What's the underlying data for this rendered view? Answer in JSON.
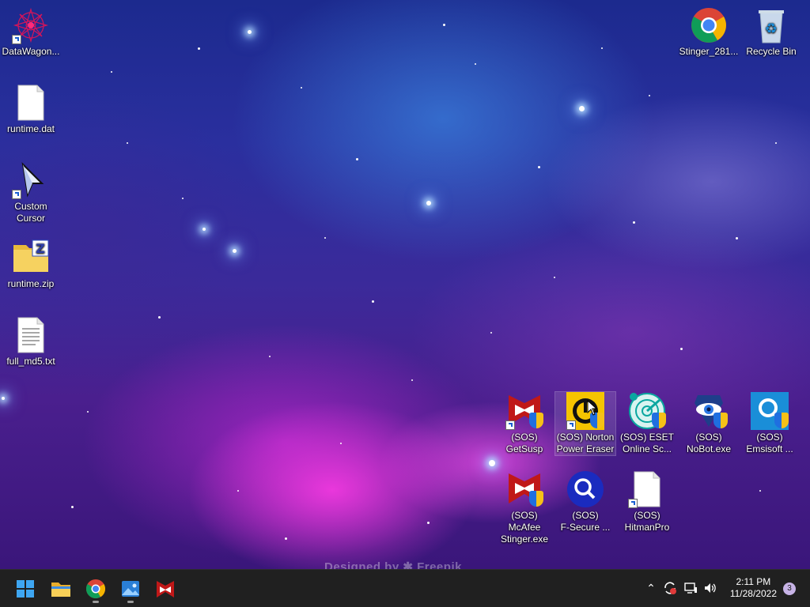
{
  "desktop": {
    "left_icons": [
      {
        "label": "DataWagon..."
      },
      {
        "label": "runtime.dat"
      },
      {
        "label": "Custom\nCursor"
      },
      {
        "label": "runtime.zip"
      },
      {
        "label": "full_md5.txt"
      }
    ],
    "top_right_icons": [
      {
        "label": "Stinger_281..."
      },
      {
        "label": "Recycle Bin"
      }
    ],
    "grid_icons": [
      {
        "label": "(SOS)\nGetSusp"
      },
      {
        "label": "(SOS) Norton\nPower Eraser"
      },
      {
        "label": "(SOS) ESET\nOnline Sc..."
      },
      {
        "label": "(SOS)\nNoBot.exe"
      },
      {
        "label": "(SOS)\nEmsisoft ..."
      },
      {
        "label": "(SOS) McAfee\nStinger.exe"
      },
      {
        "label": "(SOS)\nF-Secure ..."
      },
      {
        "label": "(SOS)\nHitmanPro"
      }
    ]
  },
  "taskbar": {
    "pinned": [
      "windows-start",
      "file-explorer",
      "chrome",
      "photos",
      "mcafee"
    ],
    "tray": {
      "time": "2:11 PM",
      "date": "11/28/2022",
      "notification_count": "3"
    }
  },
  "colors": {
    "taskbar_bg": "#202020",
    "accent": "#0078d4"
  }
}
